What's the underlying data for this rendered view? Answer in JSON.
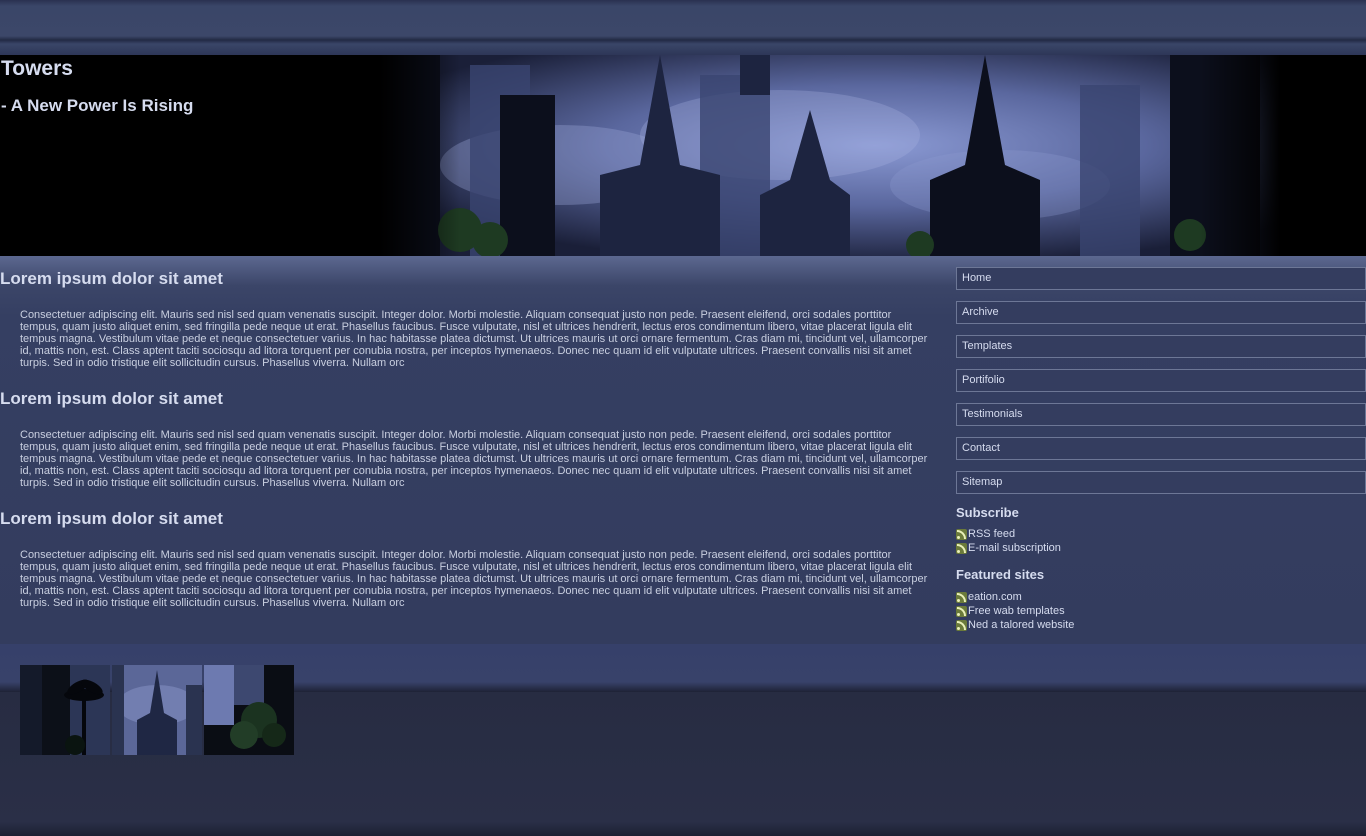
{
  "header": {
    "title": "Towers",
    "tagline": "- A New Power Is Rising"
  },
  "posts": [
    {
      "title": "Lorem ipsum dolor sit amet",
      "body": "Consectetuer adipiscing elit. Mauris sed nisl sed quam venenatis suscipit. Integer dolor. Morbi molestie. Aliquam consequat justo non pede. Praesent eleifend, orci sodales porttitor tempus, quam justo aliquet enim, sed fringilla pede neque ut erat. Phasellus faucibus. Fusce vulputate, nisl et ultrices hendrerit, lectus eros condimentum libero, vitae placerat ligula elit tempus magna. Vestibulum vitae pede et neque consectetuer varius. In hac habitasse platea dictumst. Ut ultrices mauris ut orci ornare fermentum. Cras diam mi, tincidunt vel, ullamcorper id, mattis non, est. Class aptent taciti sociosqu ad litora torquent per conubia nostra, per inceptos hymenaeos. Donec nec quam id elit vulputate ultrices. Praesent convallis nisi sit amet turpis. Sed in odio tristique elit sollicitudin cursus. Phasellus viverra. Nullam orc"
    },
    {
      "title": "Lorem ipsum dolor sit amet",
      "body": "Consectetuer adipiscing elit. Mauris sed nisl sed quam venenatis suscipit. Integer dolor. Morbi molestie. Aliquam consequat justo non pede. Praesent eleifend, orci sodales porttitor tempus, quam justo aliquet enim, sed fringilla pede neque ut erat. Phasellus faucibus. Fusce vulputate, nisl et ultrices hendrerit, lectus eros condimentum libero, vitae placerat ligula elit tempus magna. Vestibulum vitae pede et neque consectetuer varius. In hac habitasse platea dictumst. Ut ultrices mauris ut orci ornare fermentum. Cras diam mi, tincidunt vel, ullamcorper id, mattis non, est. Class aptent taciti sociosqu ad litora torquent per conubia nostra, per inceptos hymenaeos. Donec nec quam id elit vulputate ultrices. Praesent convallis nisi sit amet turpis. Sed in odio tristique elit sollicitudin cursus. Phasellus viverra. Nullam orc"
    },
    {
      "title": "Lorem ipsum dolor sit amet",
      "body": "Consectetuer adipiscing elit. Mauris sed nisl sed quam venenatis suscipit. Integer dolor. Morbi molestie. Aliquam consequat justo non pede. Praesent eleifend, orci sodales porttitor tempus, quam justo aliquet enim, sed fringilla pede neque ut erat. Phasellus faucibus. Fusce vulputate, nisl et ultrices hendrerit, lectus eros condimentum libero, vitae placerat ligula elit tempus magna. Vestibulum vitae pede et neque consectetuer varius. In hac habitasse platea dictumst. Ut ultrices mauris ut orci ornare fermentum. Cras diam mi, tincidunt vel, ullamcorper id, mattis non, est. Class aptent taciti sociosqu ad litora torquent per conubia nostra, per inceptos hymenaeos. Donec nec quam id elit vulputate ultrices. Praesent convallis nisi sit amet turpis. Sed in odio tristique elit sollicitudin cursus. Phasellus viverra. Nullam orc"
    }
  ],
  "sidebar": {
    "nav": [
      "Home",
      "Archive",
      "Templates",
      "Portifolio",
      "Testimonials",
      "Contact",
      "Sitemap"
    ],
    "subscribe": {
      "heading": "Subscribe",
      "items": [
        "RSS feed",
        "E-mail subscription"
      ]
    },
    "featured": {
      "heading": "Featured sites",
      "items": [
        "eation.com",
        "Free wab templates",
        "Ned a talored website"
      ]
    }
  },
  "colors": {
    "background": "#2b3046",
    "panel": "#343d5f",
    "text": "#d6dcef",
    "rss": "#6b7a3a"
  },
  "icons": {
    "feed": "rss-icon"
  }
}
